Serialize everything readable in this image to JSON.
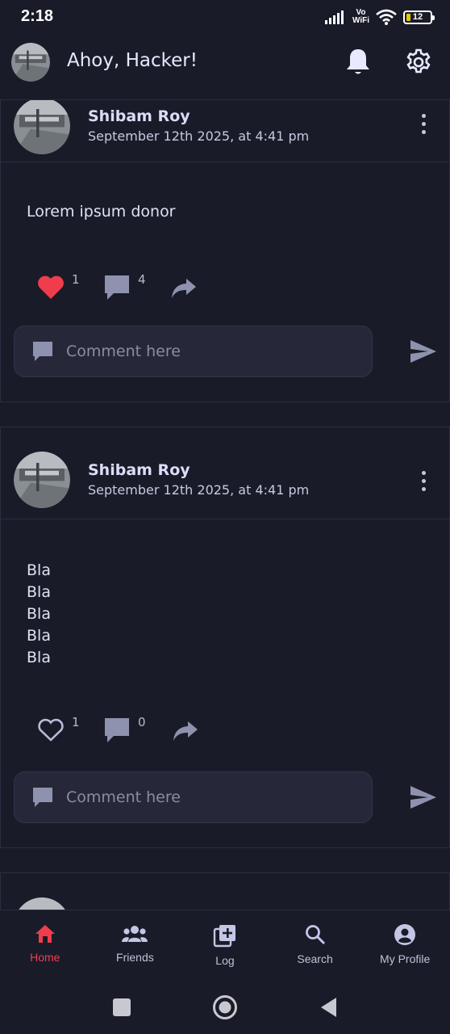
{
  "status_bar": {
    "time": "2:18",
    "battery": "12",
    "vowifi_top": "Vo",
    "vowifi_bottom": "WiFi"
  },
  "header": {
    "greeting": "Ahoy, Hacker!"
  },
  "posts": [
    {
      "author": "Shibam Roy",
      "date": "September 12th 2025, at 4:41 pm",
      "body": "Lorem ipsum donor",
      "liked": true,
      "likes": "1",
      "comments": "4",
      "comment_placeholder": "Comment here"
    },
    {
      "author": "Shibam Roy",
      "date": "September 12th 2025, at 4:41 pm",
      "body": "Bla\nBla\nBla\nBla\nBla",
      "liked": false,
      "likes": "1",
      "comments": "0",
      "comment_placeholder": "Comment here"
    }
  ],
  "nav": [
    {
      "label": "Home",
      "icon": "home-icon",
      "active": true
    },
    {
      "label": "Friends",
      "icon": "friends-icon",
      "active": false
    },
    {
      "label": "Log",
      "icon": "add-post-icon",
      "active": false
    },
    {
      "label": "Search",
      "icon": "search-icon",
      "active": false
    },
    {
      "label": "My Profile",
      "icon": "profile-icon",
      "active": false
    }
  ],
  "colors": {
    "background": "#1a1b29",
    "accent": "#ef3d4c",
    "card": "#262839",
    "text": "#dcdcf0"
  }
}
